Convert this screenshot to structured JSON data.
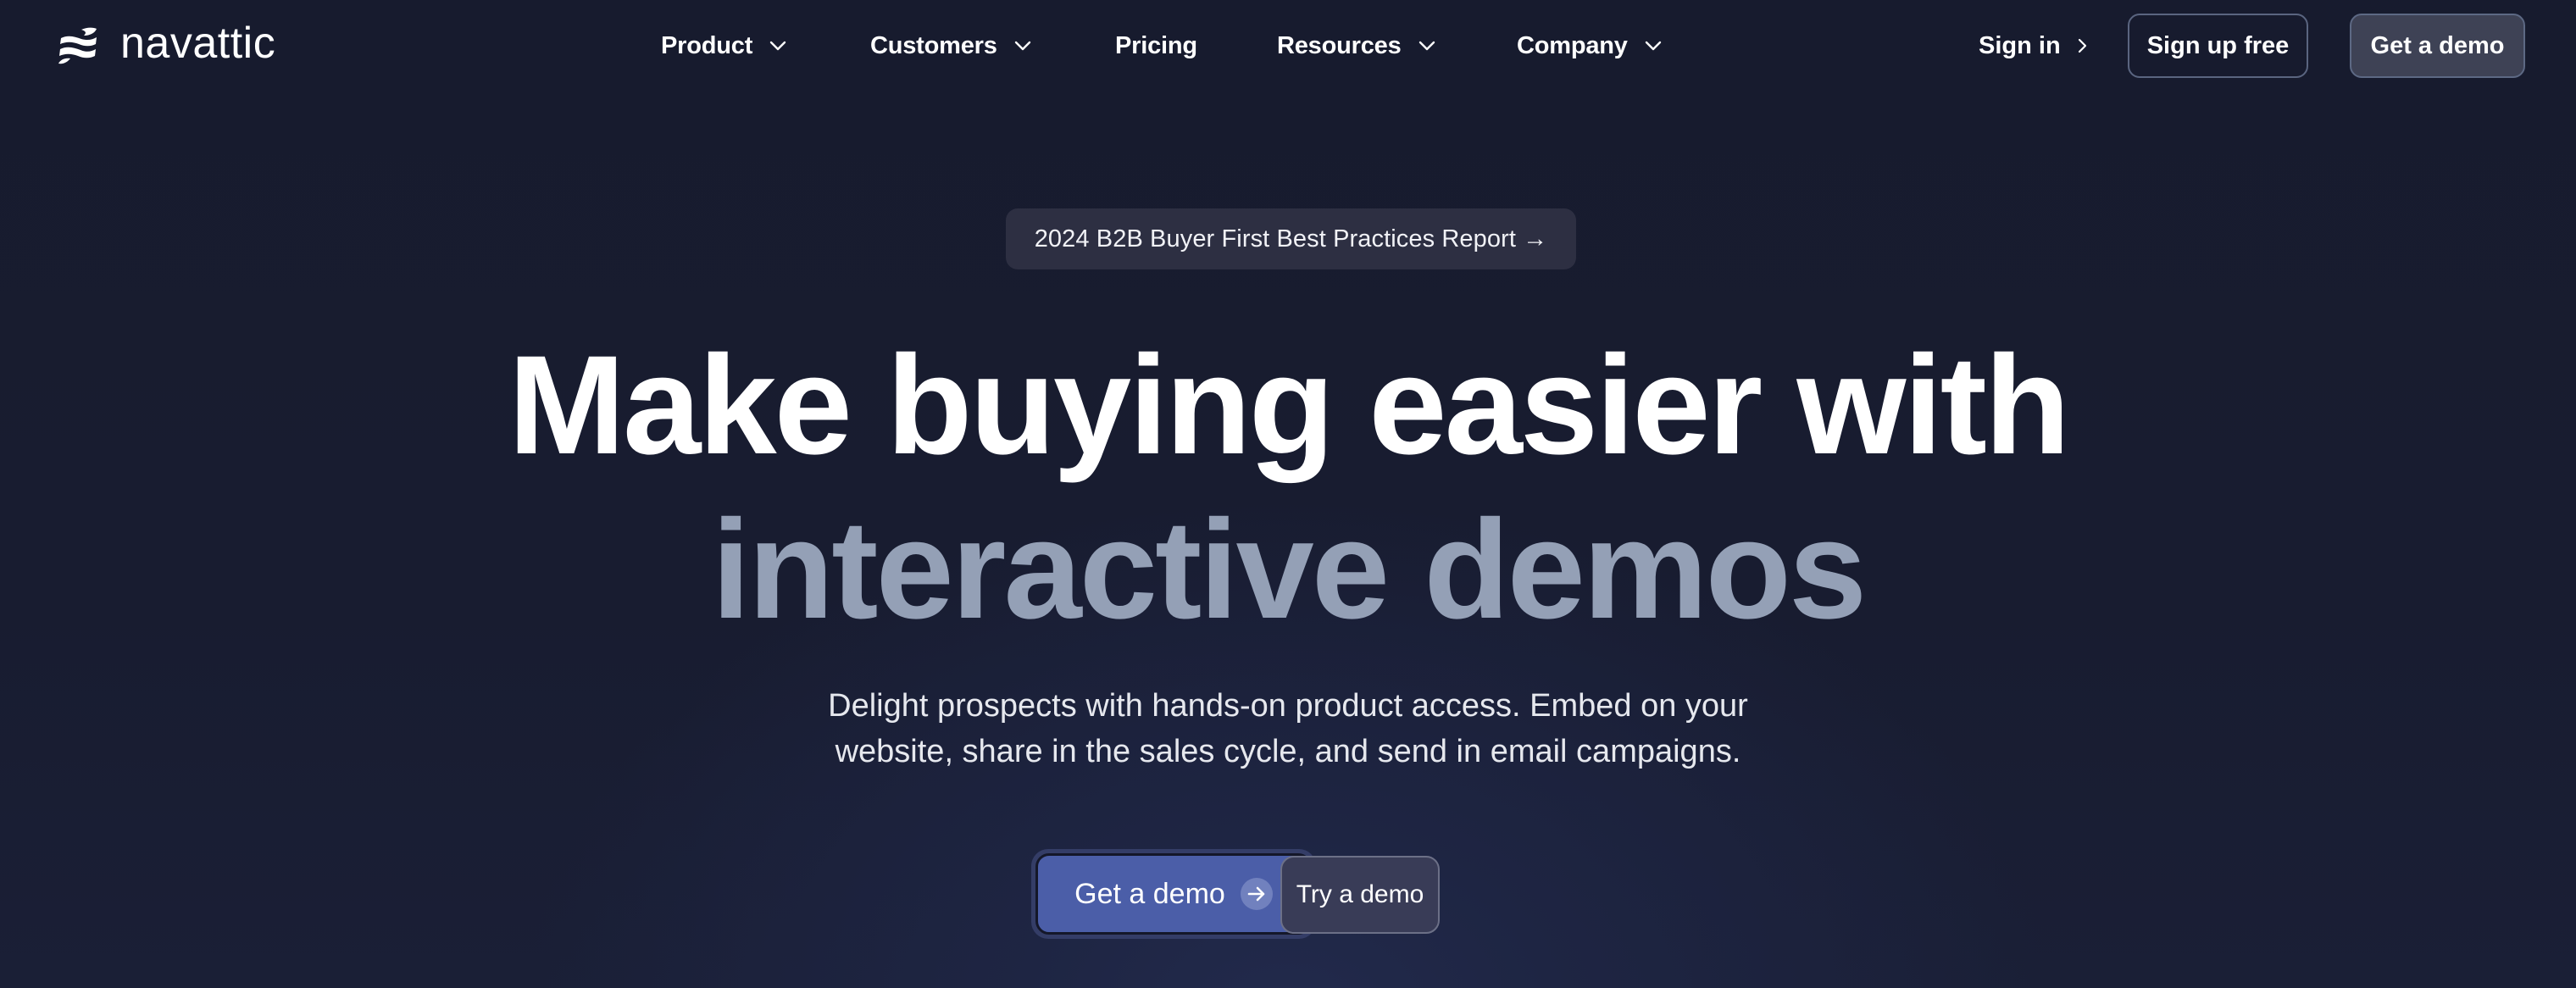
{
  "header": {
    "brand": "navattic",
    "logo_icon": "navattic-wave-logo-icon",
    "nav": [
      {
        "label": "Product",
        "has_dropdown": true
      },
      {
        "label": "Customers",
        "has_dropdown": true
      },
      {
        "label": "Pricing",
        "has_dropdown": false
      },
      {
        "label": "Resources",
        "has_dropdown": true
      },
      {
        "label": "Company",
        "has_dropdown": true
      }
    ],
    "sign_in": "Sign in",
    "sign_up": "Sign up free",
    "get_demo": "Get a demo"
  },
  "hero": {
    "badge": "2024 B2B Buyer First Best Practices Report →",
    "headline_line1": "Make buying easier with",
    "headline_line2": "interactive demos",
    "subtitle_line1": "Delight prospects with hands-on product access. Embed on your",
    "subtitle_line2": "website, share in the sales cycle, and send in email campaigns.",
    "primary_cta": "Get a demo",
    "secondary_cta": "Try a demo"
  },
  "colors": {
    "background": "#161a2d",
    "glow": "#222a4c",
    "headline_accent": "#94a0b6",
    "primary_button": "#4b5ea8",
    "badge_bg": "#2d2f42"
  }
}
